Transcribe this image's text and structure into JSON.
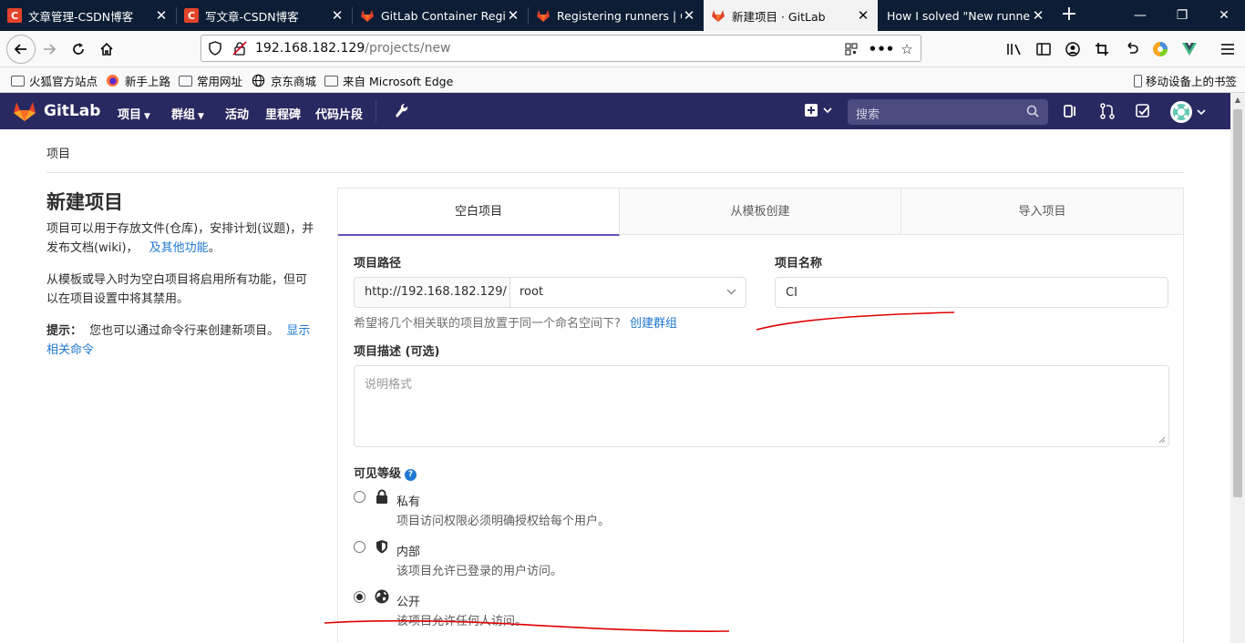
{
  "browser": {
    "tabs": [
      {
        "title": "文章管理-CSDN博客",
        "favicon": "csdn-icon",
        "active": false
      },
      {
        "title": "写文章-CSDN博客",
        "favicon": "csdn-icon",
        "active": false
      },
      {
        "title": "GitLab Container Regis",
        "favicon": "gitlab-icon",
        "active": false
      },
      {
        "title": "Registering runners | G",
        "favicon": "gitlab-icon",
        "active": false
      },
      {
        "title": "新建项目 · GitLab",
        "favicon": "gitlab-icon",
        "active": true
      },
      {
        "title": "How I solved \"New runner",
        "favicon": "page-icon",
        "active": false
      }
    ],
    "favicon_letter": "C",
    "close_glyph": "✕",
    "url_host": "192.168.182.129",
    "url_path": "/projects/new",
    "bookmarks": [
      {
        "label": "火狐官方站点",
        "icon": "folder-icon"
      },
      {
        "label": "新手上路",
        "icon": "firefox-icon"
      },
      {
        "label": "常用网址",
        "icon": "folder-icon"
      },
      {
        "label": "京东商城",
        "icon": "globe-icon"
      },
      {
        "label": "来自 Microsoft Edge",
        "icon": "folder-icon"
      }
    ],
    "mobile_bookmarks": "移动设备上的书签"
  },
  "gitlab": {
    "brand": "GitLab",
    "nav": [
      {
        "label": "项目",
        "dropdown": true
      },
      {
        "label": "群组",
        "dropdown": true
      },
      {
        "label": "活动",
        "dropdown": false
      },
      {
        "label": "里程碑",
        "dropdown": false
      },
      {
        "label": "代码片段",
        "dropdown": false
      }
    ],
    "search_placeholder": "搜索",
    "header_color": "#292961"
  },
  "page": {
    "breadcrumb": "项目",
    "title": "新建项目",
    "intro_text": "项目可以用于存放文件(仓库)，安排计划(议题)，并发布文档(wiki)，",
    "intro_link": "及其他功能",
    "intro_end": "。",
    "template_text": "从模板或导入时为空白项目将启用所有功能，但可以在项目设置中将其禁用。",
    "tip_label": "提示：",
    "tip_text": "您也可以通过命令行来创建新项目。",
    "tip_link": "显示相关命令"
  },
  "form": {
    "tabs": [
      "空白项目",
      "从模板创建",
      "导入项目"
    ],
    "active_tab": 0,
    "path_label": "项目路径",
    "path_prefix": "http://192.168.182.129/",
    "namespace": "root",
    "name_label": "项目名称",
    "name_value": "CI",
    "namespace_hint": "希望将几个相关联的项目放置于同一个命名空间下?",
    "create_group_link": "创建群组",
    "desc_label": "项目描述 (可选)",
    "desc_placeholder": "说明格式",
    "visibility_label": "可见等级",
    "visibility": [
      {
        "name": "私有",
        "desc": "项目访问权限必须明确授权给每个用户。",
        "icon": "lock-icon",
        "checked": false
      },
      {
        "name": "内部",
        "desc": "该项目允许已登录的用户访问。",
        "icon": "shield-icon",
        "checked": false
      },
      {
        "name": "公开",
        "desc": "该项目允许任何人访问。",
        "icon": "earth-icon",
        "checked": true
      }
    ],
    "accent_color": "#6b4fbb",
    "link_color": "#1f78d1",
    "annotation_color": "#e00000"
  }
}
